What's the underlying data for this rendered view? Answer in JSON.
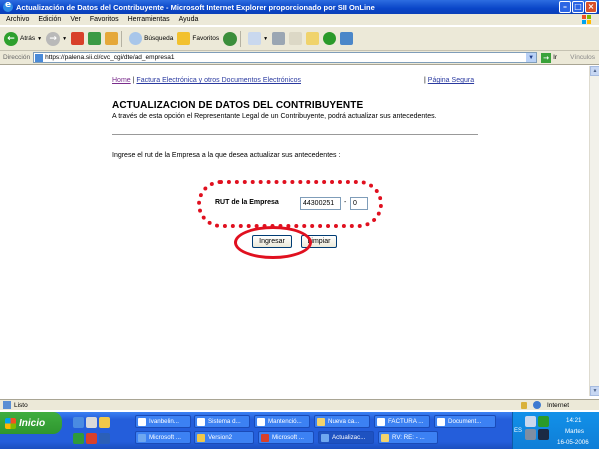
{
  "window": {
    "title": "Actualización de Datos del Contribuyente - Microsoft Internet Explorer proporcionado por SII OnLine"
  },
  "menu": [
    "Archivo",
    "Edición",
    "Ver",
    "Favoritos",
    "Herramientas",
    "Ayuda"
  ],
  "toolbar": {
    "back_label": "Atrás",
    "search_label": "Búsqueda",
    "favorites_label": "Favoritos"
  },
  "address": {
    "label": "Dirección",
    "url": "https://palena.sii.cl/cvc_cgi/dte/ad_empresa1",
    "go_label": "Ir",
    "links_label": "Vínculos"
  },
  "page": {
    "nav": {
      "home": "Home",
      "separator": "|",
      "factura": "Factura Electrónica y otros Documentos Electrónicos",
      "secure": "Página Segura"
    },
    "title": "ACTUALIZACION DE DATOS DEL CONTRIBUYENTE",
    "subtitle": "A través de esta opción el Representante Legal de un Contribuyente, podrá actualizar sus antecedentes.",
    "instruction": "Ingrese el rut de la Empresa a la que desea actualizar sus antecedentes :",
    "form": {
      "rut_label": "RUT de la Empresa",
      "rut_value": "44300251",
      "dash": "-",
      "dv_value": "0",
      "submit_label": "Ingresar",
      "clear_label": "Limpiar"
    },
    "annotation_color": "#e0101f"
  },
  "status": {
    "text": "Listo",
    "zone": "Internet"
  },
  "taskbar": {
    "start_label": "Inicio",
    "tasks_row1": [
      "Ivanbelin...",
      "Sistema d...",
      "Mantenció...",
      "Nueva ca...",
      "FACTURA ...",
      "Document..."
    ],
    "tasks_row2": [
      "Microsoft ...",
      "Version2",
      "Microsoft ...",
      "Actualizac...",
      "RV: RE: - ..."
    ],
    "lang": "ES",
    "time": "14:21",
    "day": "Martes",
    "date": "16-05-2006"
  }
}
